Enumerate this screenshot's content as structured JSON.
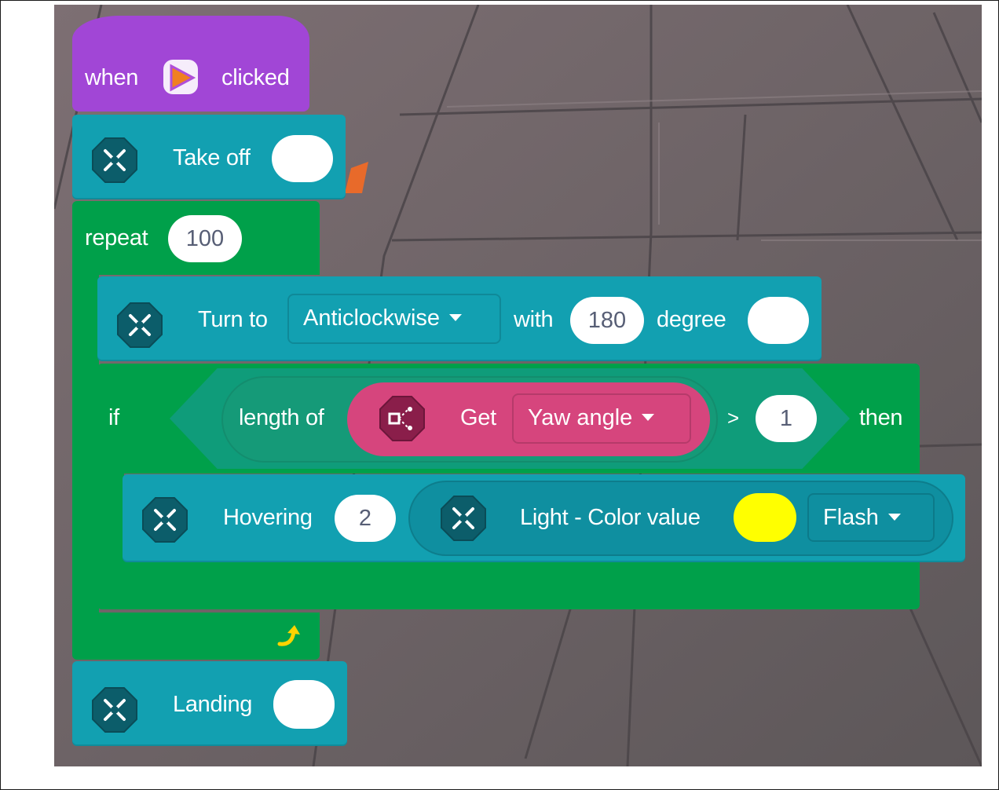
{
  "hat": {
    "when": "when",
    "clicked": "clicked",
    "icon": "play-flag-icon"
  },
  "takeoff": {
    "label": "Take off",
    "icon": "drone-icon"
  },
  "repeat": {
    "label": "repeat",
    "count": "100"
  },
  "turn": {
    "label": "Turn to",
    "direction": "Anticlockwise",
    "with": "with",
    "angle": "180",
    "unit": "degree"
  },
  "if_block": {
    "if_label": "if",
    "length_of": "length of",
    "get": "Get",
    "sensor": "Yaw angle",
    "operator": ">",
    "value": "1",
    "then": "then"
  },
  "hover": {
    "label": "Hovering",
    "seconds": "2",
    "light_label": "Light - Color value",
    "light_color": "#ffff00",
    "mode": "Flash"
  },
  "landing": {
    "label": "Landing"
  },
  "colors": {
    "event": "#a146d6",
    "drone": "#12a0b1",
    "control": "#00a04a",
    "sensor": "#d6457d",
    "loop_arrow": "#ffd300"
  }
}
